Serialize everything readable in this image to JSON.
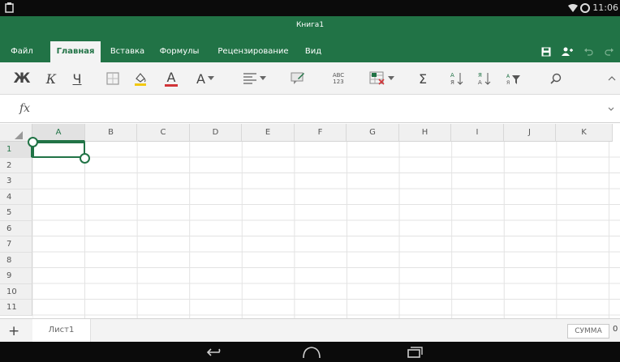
{
  "status_bar": {
    "time": "11:06"
  },
  "window": {
    "title": "Книга1"
  },
  "ribbon": {
    "tabs": [
      {
        "label": "Файл",
        "active": false
      },
      {
        "label": "Главная",
        "active": true
      },
      {
        "label": "Вставка",
        "active": false
      },
      {
        "label": "Формулы",
        "active": false
      },
      {
        "label": "Рецензирование",
        "active": false
      },
      {
        "label": "Вид",
        "active": false
      }
    ],
    "right_icons": [
      "save-icon",
      "share-icon",
      "undo-icon",
      "redo-icon"
    ]
  },
  "toolbar": {
    "bold": "Ж",
    "italic": "К",
    "underline": "Ч",
    "font_color_letter": "А",
    "font_size_letter": "А",
    "wrap_text_label": "ABC\n123",
    "sum_symbol": "Σ",
    "highlight_color": "#f2c811",
    "font_color": "#d13438"
  },
  "formula_bar": {
    "fx": "fx",
    "value": ""
  },
  "grid": {
    "columns": [
      "A",
      "B",
      "C",
      "D",
      "E",
      "F",
      "G",
      "H",
      "I",
      "J",
      "K"
    ],
    "rows": [
      "1",
      "2",
      "3",
      "4",
      "5",
      "6",
      "7",
      "8",
      "9",
      "10",
      "11"
    ],
    "selected_cell": "A1"
  },
  "sheet_bar": {
    "add_label": "+",
    "sheets": [
      "Лист1"
    ],
    "sum_label": "СУММА",
    "sum_value": "0"
  },
  "colors": {
    "accent": "#217346"
  }
}
